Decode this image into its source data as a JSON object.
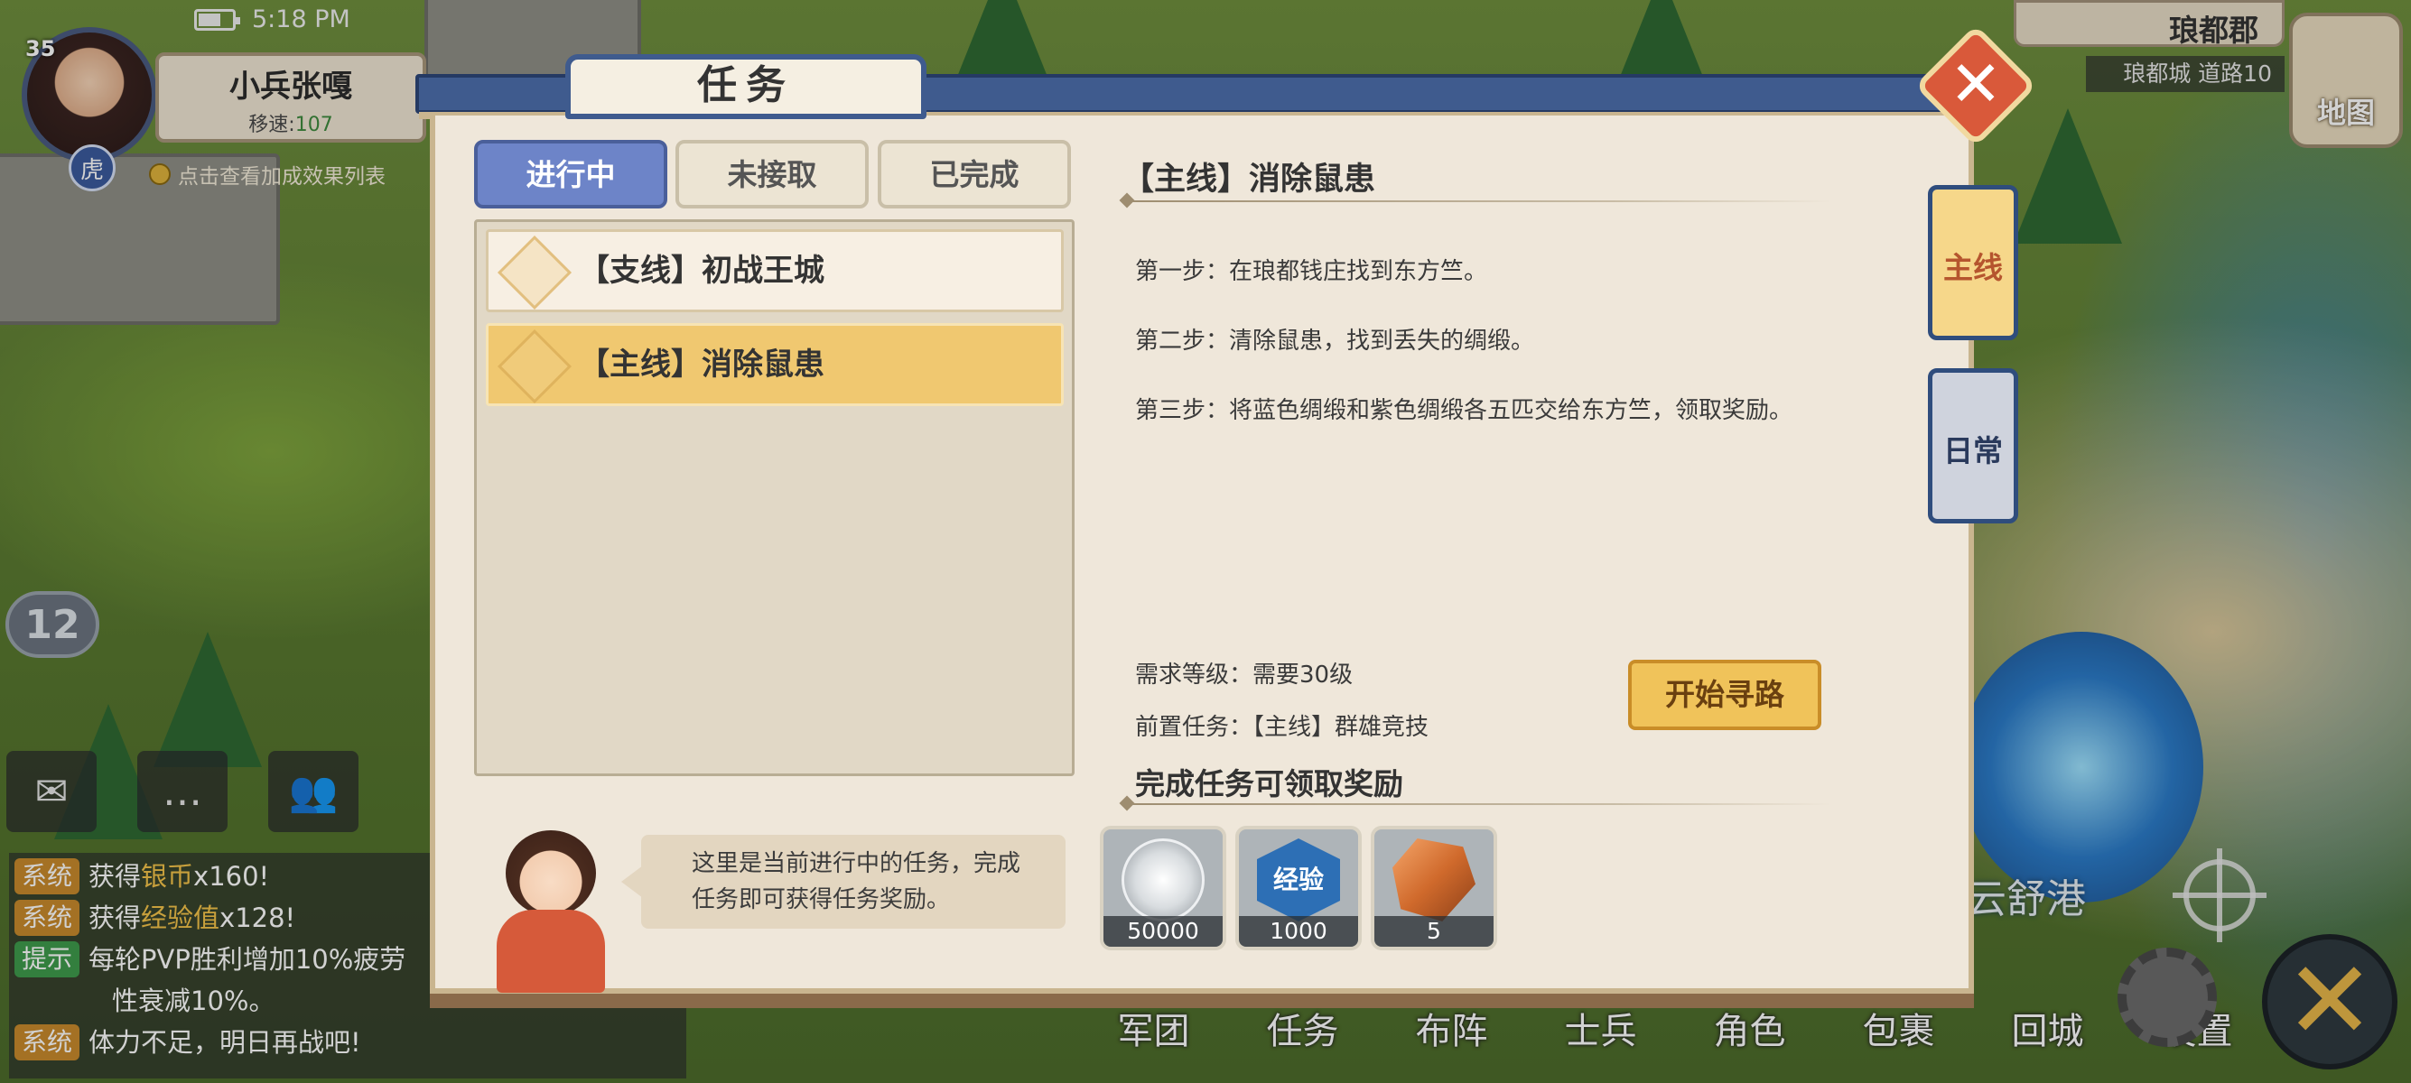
{
  "status": {
    "time": "5:18 PM"
  },
  "player": {
    "level": "35",
    "name": "小兵张嘎",
    "speed_label": "移速:",
    "speed_value": "107",
    "zodiac": "虎",
    "bonus_hint": "点击查看加成效果列表",
    "map_level": "12"
  },
  "location": {
    "region": "琅都郡",
    "sub": "琅都城 道路10",
    "map_label": "地图",
    "harbor": "云舒港"
  },
  "quick_buttons": [
    {
      "icon": "mail-icon"
    },
    {
      "icon": "chat-icon"
    },
    {
      "icon": "friends-icon"
    }
  ],
  "chat": [
    {
      "tag": "系统",
      "pre": "获得",
      "hl": "银币",
      "post": "x160!"
    },
    {
      "tag": "系统",
      "pre": "获得",
      "hl": "经验值",
      "post": "x128!"
    },
    {
      "tag": "提示",
      "pre": "每轮PVP胜利增加10%疲劳",
      "hl": "",
      "post": ""
    },
    {
      "tag": "",
      "pre": "性衰减10%。",
      "hl": "",
      "post": ""
    },
    {
      "tag": "系统",
      "pre": "体力不足，明日再战吧!",
      "hl": "",
      "post": ""
    }
  ],
  "bottom_menu": [
    "军团",
    "任务",
    "布阵",
    "士兵",
    "角色",
    "包裹",
    "回城",
    "设置"
  ],
  "dialog": {
    "title": "任务",
    "tabs": [
      "进行中",
      "未接取",
      "已完成"
    ],
    "active_tab": "进行中",
    "quests": [
      "【支线】初战王城",
      "【主线】消除鼠患"
    ],
    "selected_quest": "【主线】消除鼠患",
    "guide_text_1": "这里是当前进行中的任务，完成",
    "guide_text_2": "任务即可获得任务奖励。",
    "detail": {
      "title": "【主线】消除鼠患",
      "steps": [
        "第一步：在琅都钱庄找到东方竺。",
        "第二步：清除鼠患，找到丢失的绸缎。",
        "第三步：将蓝色绸缎和紫色绸缎各五匹交给东方竺，领取奖励。"
      ],
      "req_level": "需求等级：需要30级",
      "pre_quest": "前置任务：【主线】群雄竞技",
      "route_button": "开始寻路",
      "reward_title": "完成任务可领取奖励",
      "rewards": [
        {
          "icon": "silver-coin-icon",
          "qty": "50000"
        },
        {
          "icon": "exp-icon",
          "label": "经验",
          "qty": "1000"
        },
        {
          "icon": "ore-icon",
          "qty": "5"
        }
      ]
    },
    "side_tabs": [
      "主线",
      "日常"
    ],
    "active_side_tab": "主线"
  }
}
